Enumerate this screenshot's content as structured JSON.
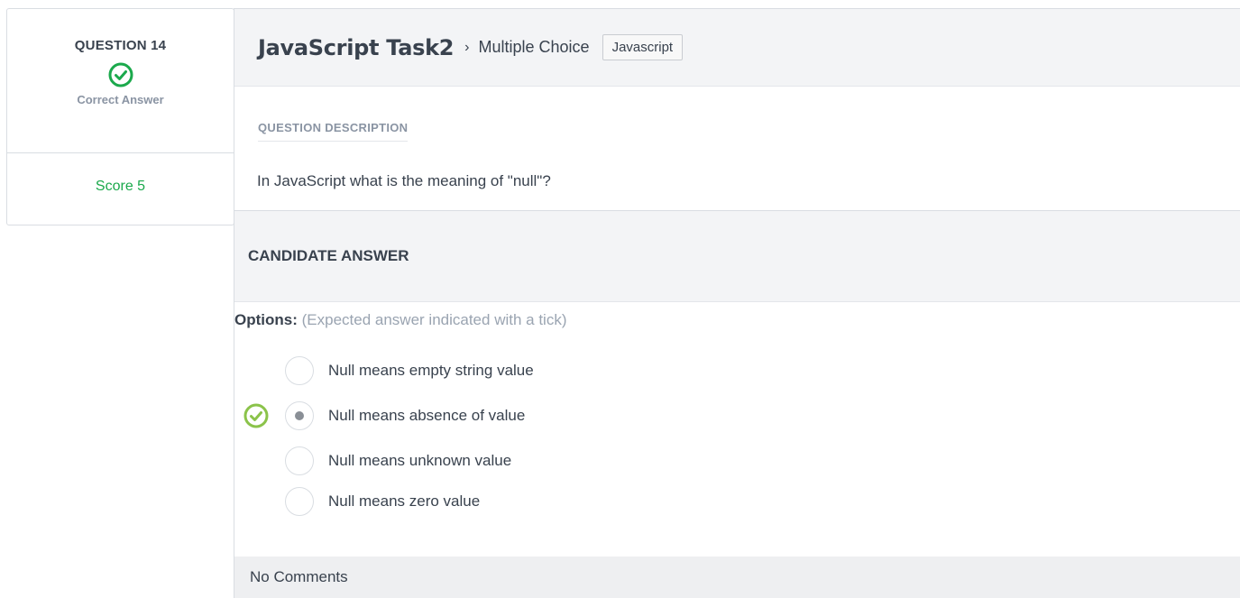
{
  "question": {
    "label": "QUESTION 14",
    "status": "Correct Answer",
    "score": "Score 5"
  },
  "header": {
    "title": "JavaScript Task2",
    "separator": "›",
    "type": "Multiple Choice",
    "tag": "Javascript"
  },
  "description": {
    "heading": "QUESTION DESCRIPTION",
    "text": "In JavaScript what is the meaning of \"null\"?"
  },
  "candidate": {
    "heading": "CANDIDATE ANSWER",
    "options_label": "Options:",
    "options_note": "(Expected answer indicated with a tick)",
    "options": [
      {
        "label": "Null means empty string value",
        "selected": false,
        "expected": false
      },
      {
        "label": "Null means absence of value",
        "selected": true,
        "expected": true
      },
      {
        "label": "Null means unknown value",
        "selected": false,
        "expected": false
      },
      {
        "label": "Null means zero value",
        "selected": false,
        "expected": false
      }
    ]
  },
  "comments": "No Comments",
  "colors": {
    "success": "#1ba94c",
    "tick": "#8bc34a"
  }
}
